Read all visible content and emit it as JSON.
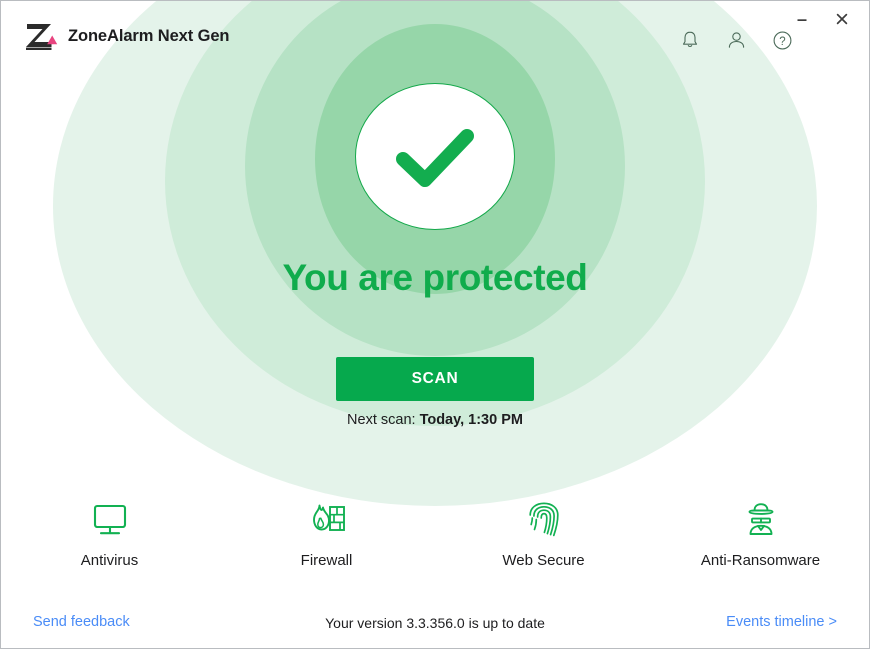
{
  "window": {
    "title": "ZoneAlarm Next Gen",
    "logo_icon": "zonealarm-z-logo",
    "minimize_label": "–",
    "close_label": "×",
    "minimize_icon": "minimize-icon",
    "close_icon": "close-icon"
  },
  "toolbar": {
    "notifications_icon": "bell-icon",
    "account_icon": "person-icon",
    "help_icon": "question-mark-circle-icon"
  },
  "hero": {
    "status_icon": "green-checkmark-icon",
    "status_text": "You are protected",
    "scan_button_label": "SCAN",
    "next_scan_prefix": "Next scan:",
    "next_scan_time": "Today, 1:30 PM"
  },
  "features": [
    {
      "label": "Antivirus",
      "icon": "monitor-icon"
    },
    {
      "label": "Firewall",
      "icon": "firewall-flame-brick-icon"
    },
    {
      "label": "Web Secure",
      "icon": "fingerprint-icon"
    },
    {
      "label": "Anti-Ransomware",
      "icon": "spy-hacker-icon"
    }
  ],
  "footer": {
    "send_feedback_label": "Send feedback",
    "version_text": "Your version 3.3.356.0 is up to date",
    "events_timeline_label": "Events timeline >"
  },
  "colors": {
    "accent_green": "#06a94d",
    "status_green": "#10ac4c",
    "feature_green": "#12b152",
    "link_blue": "#4a8cf7",
    "logo_pink": "#e8447f",
    "logo_dark": "#2b2b2b",
    "ring_outer": "#e4f3ea",
    "ring_mid": "#c8e9d4",
    "ring_inner": "#a9ddba",
    "ring_core": "#93d5a7"
  }
}
